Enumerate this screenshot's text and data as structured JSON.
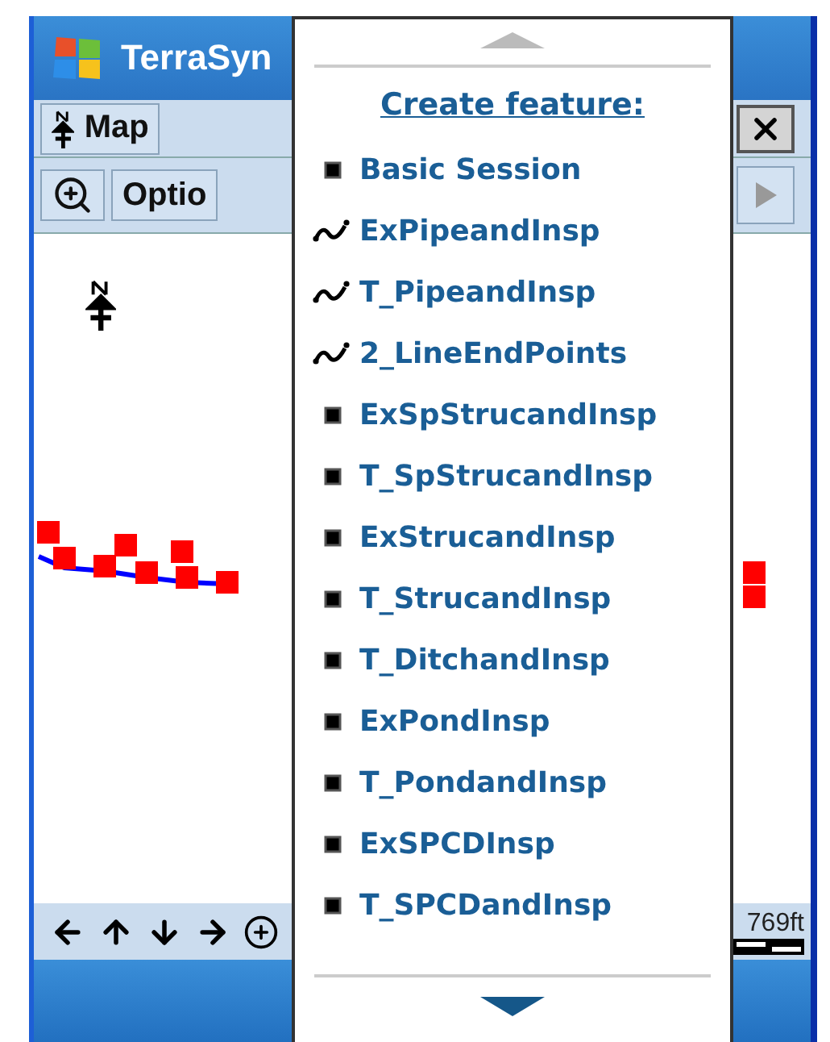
{
  "window": {
    "title": "TerraSyn"
  },
  "toolbar": {
    "map_button": "Map",
    "options_button": "Optio"
  },
  "map": {
    "scale": "769ft"
  },
  "menu": {
    "heading": "Create feature:",
    "items": [
      {
        "label": "Basic Session",
        "kind": "point"
      },
      {
        "label": "ExPipeandInsp",
        "kind": "line"
      },
      {
        "label": "T_PipeandInsp",
        "kind": "line"
      },
      {
        "label": "2_LineEndPoints",
        "kind": "line"
      },
      {
        "label": "ExSpStrucandInsp",
        "kind": "point"
      },
      {
        "label": "T_SpStrucandInsp",
        "kind": "point"
      },
      {
        "label": "ExStrucandInsp",
        "kind": "point"
      },
      {
        "label": "T_StrucandInsp",
        "kind": "point"
      },
      {
        "label": "T_DitchandInsp",
        "kind": "point"
      },
      {
        "label": "ExPondInsp",
        "kind": "point"
      },
      {
        "label": "T_PondandInsp",
        "kind": "point"
      },
      {
        "label": "ExSPCDInsp",
        "kind": "point"
      },
      {
        "label": "T_SPCDandInsp",
        "kind": "point"
      }
    ]
  }
}
